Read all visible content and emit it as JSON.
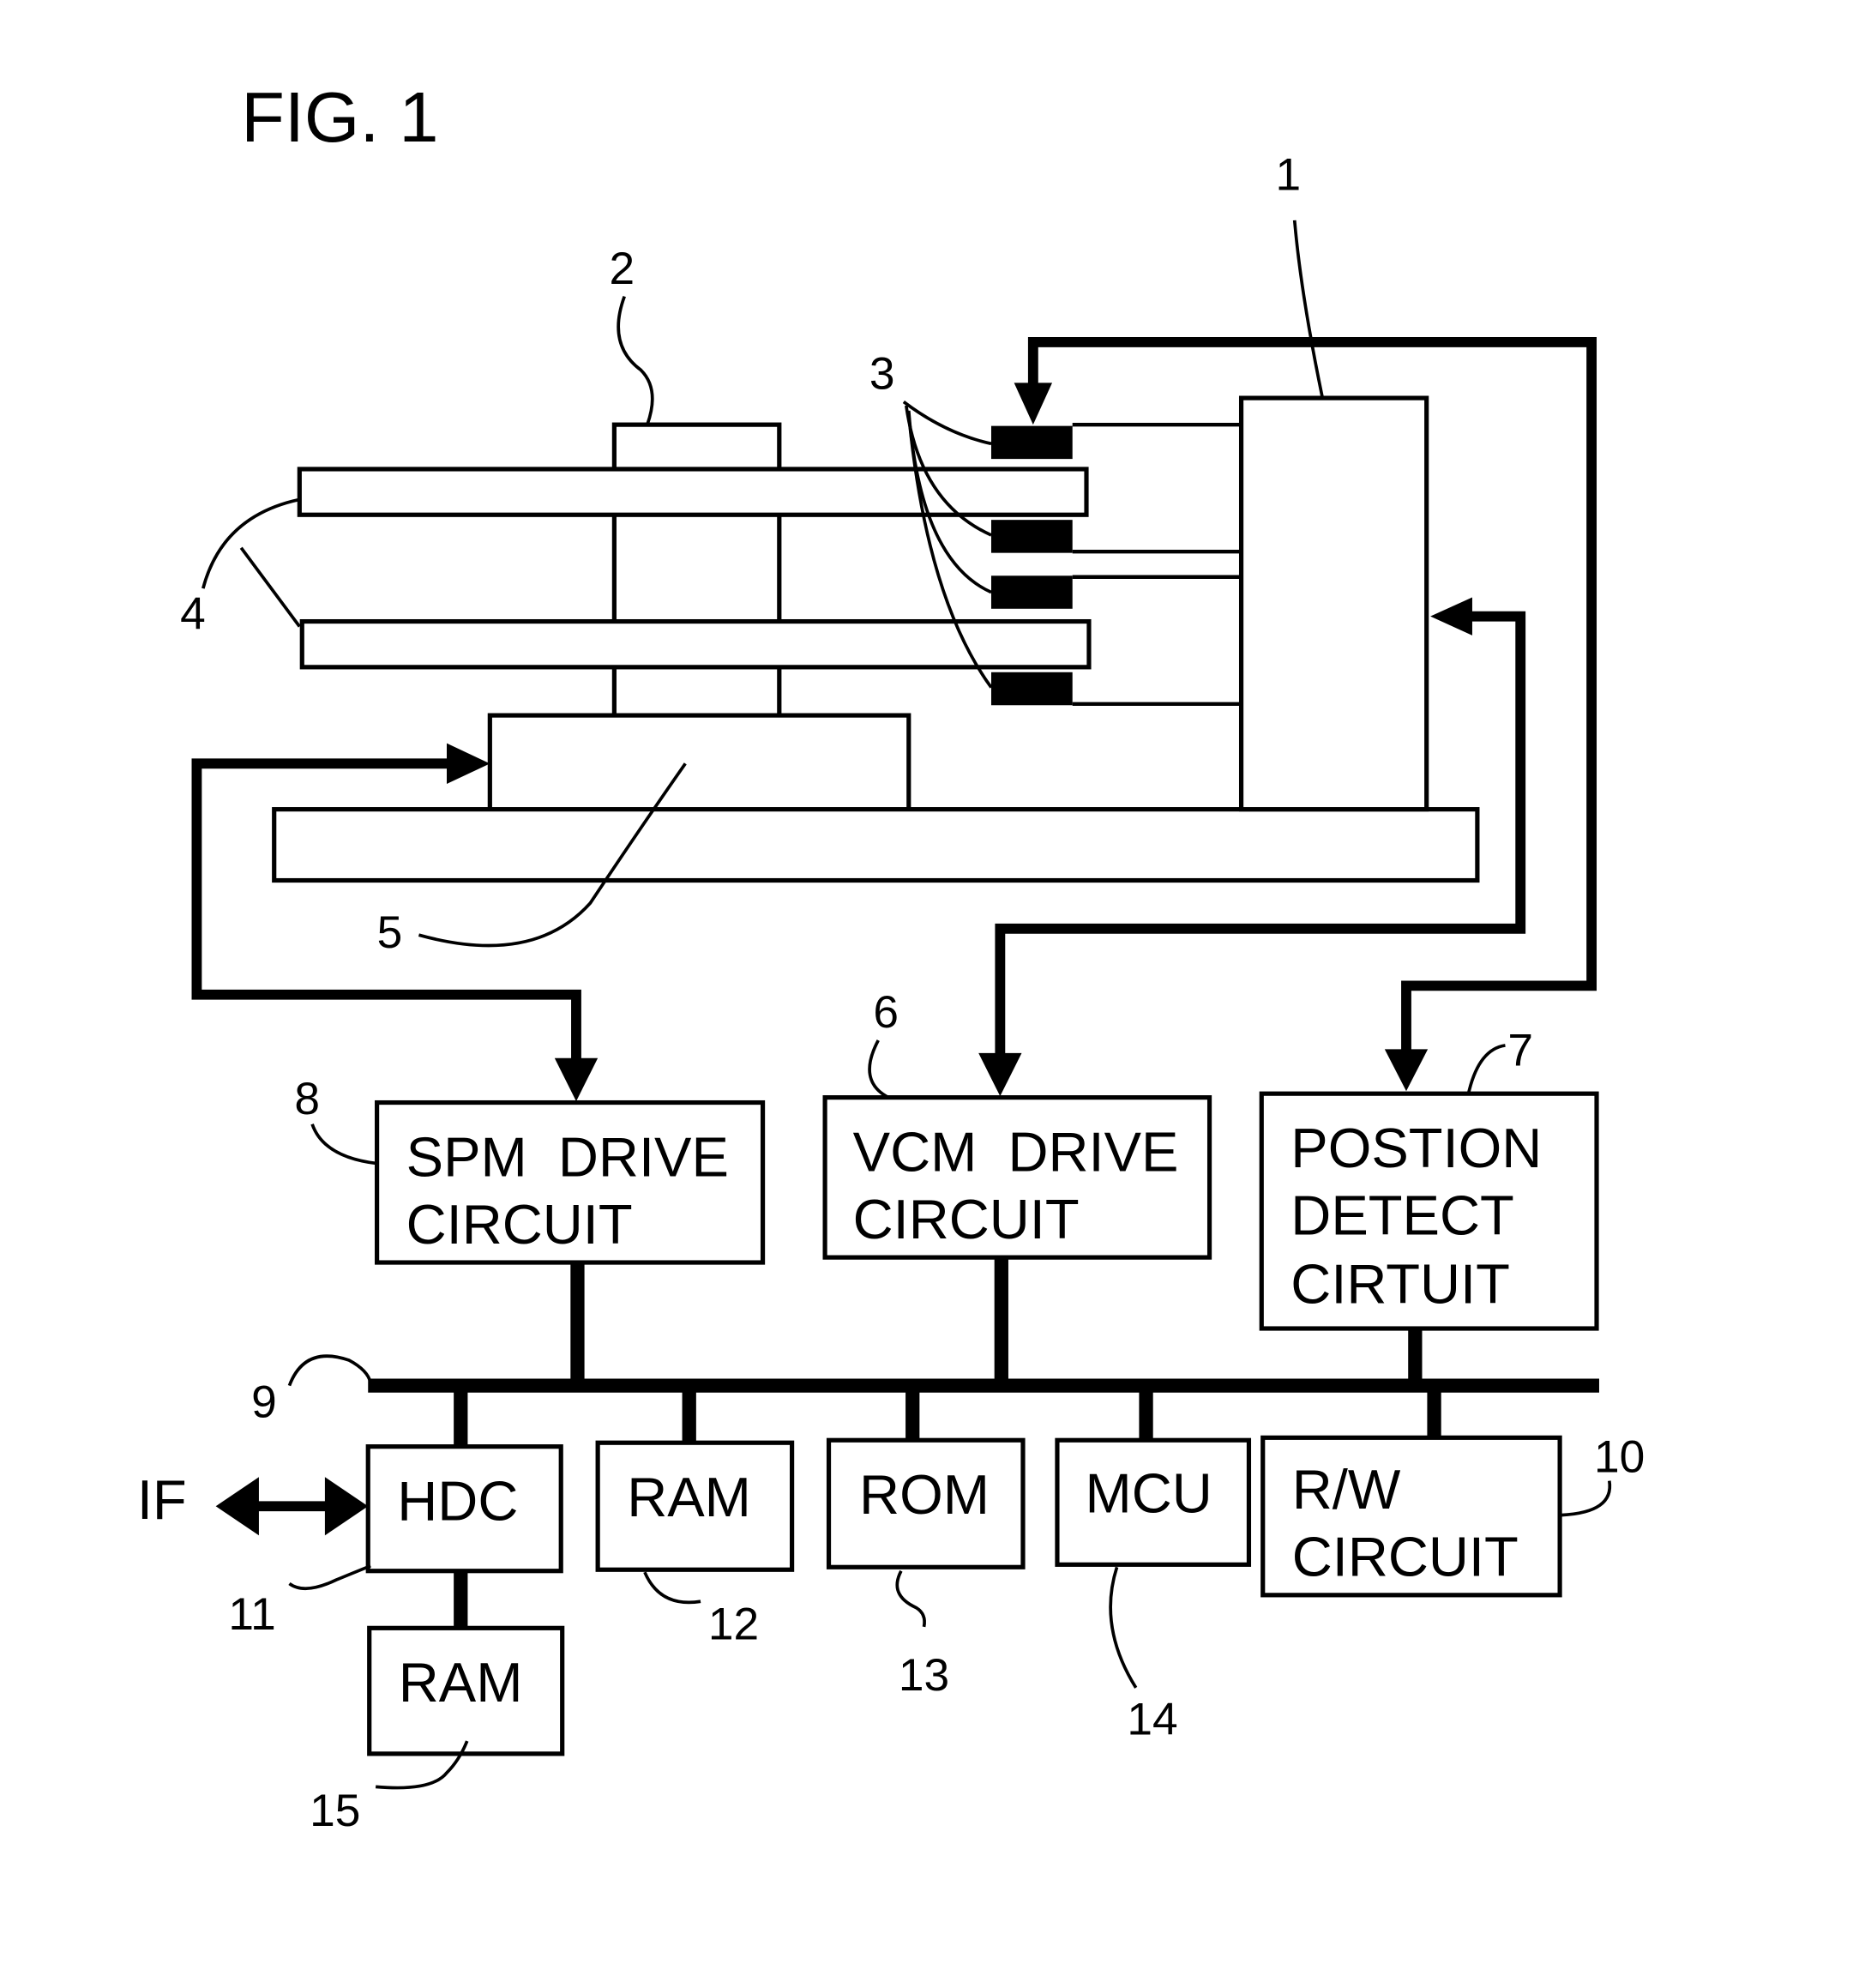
{
  "figure": {
    "title": "FIG. 1"
  },
  "components": {
    "spm_drive": {
      "ref": "8",
      "line1": "SPM  DRIVE",
      "line2": "CIRCUIT"
    },
    "vcm_drive": {
      "ref": "6",
      "line1": "VCM  DRIVE",
      "line2": "CIRCUIT"
    },
    "position_detect": {
      "ref": "7",
      "line1": "POSTION",
      "line2": "DETECT",
      "line3": "CIRTUIT"
    },
    "hdc": {
      "ref": "11",
      "label": "HDC"
    },
    "ram_main": {
      "ref": "12",
      "label": "RAM"
    },
    "rom": {
      "ref": "13",
      "label": "ROM"
    },
    "mcu": {
      "ref": "14",
      "label": "MCU"
    },
    "rw_circuit": {
      "ref": "10",
      "line1": "R/W",
      "line2": "CIRCUIT"
    },
    "ram_hdc": {
      "ref": "15",
      "label": "RAM"
    },
    "interface": {
      "label": "IF"
    },
    "bus": {
      "ref": "9"
    }
  },
  "mechanical": {
    "actuator_ref": "1",
    "spindle_ref": "2",
    "heads_ref": "3",
    "disks_ref": "4",
    "spindle_motor_ref": "5"
  }
}
